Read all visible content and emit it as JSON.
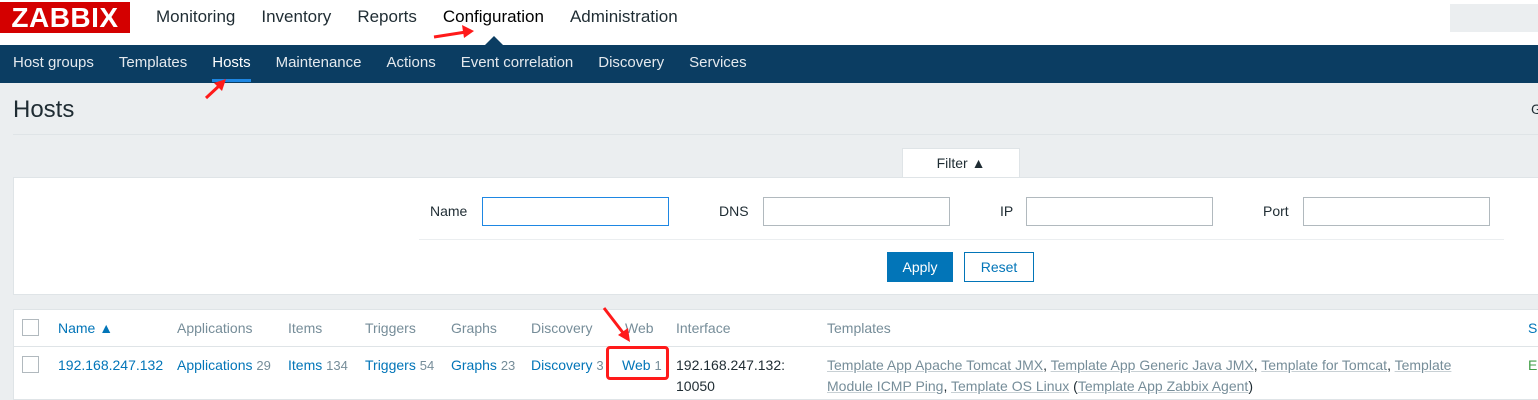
{
  "app": {
    "logo": "ZABBIX",
    "main_nav": [
      "Monitoring",
      "Inventory",
      "Reports",
      "Configuration",
      "Administration"
    ],
    "active_main": "Configuration",
    "sub_nav": [
      "Host groups",
      "Templates",
      "Hosts",
      "Maintenance",
      "Actions",
      "Event correlation",
      "Discovery",
      "Services"
    ],
    "active_sub": "Hosts"
  },
  "page": {
    "title": "Hosts",
    "right_glyph": "G"
  },
  "filter": {
    "tab_label": "Filter ▲",
    "fields": [
      {
        "label": "Name",
        "value": ""
      },
      {
        "label": "DNS",
        "value": ""
      },
      {
        "label": "IP",
        "value": ""
      },
      {
        "label": "Port",
        "value": ""
      }
    ],
    "apply_label": "Apply",
    "reset_label": "Reset"
  },
  "table": {
    "columns": [
      "Name ▲",
      "Applications",
      "Items",
      "Triggers",
      "Graphs",
      "Discovery",
      "Web",
      "Interface",
      "Templates",
      "S"
    ],
    "row": {
      "name": "192.168.247.132",
      "applications": {
        "label": "Applications",
        "count": "29"
      },
      "items": {
        "label": "Items",
        "count": "134"
      },
      "triggers": {
        "label": "Triggers",
        "count": "54"
      },
      "graphs": {
        "label": "Graphs",
        "count": "23"
      },
      "discovery": {
        "label": "Discovery",
        "count": "3"
      },
      "web": {
        "label": "Web",
        "count": "1"
      },
      "interface_line1": "192.168.247.132:",
      "interface_line2": "10050",
      "templates": [
        "Template App Apache Tomcat JMX",
        "Template App Generic Java JMX",
        "Template for Tomcat",
        "Template",
        "Module ICMP Ping",
        "Template OS Linux",
        "Template App Zabbix Agent"
      ],
      "status": "E"
    }
  },
  "colors": {
    "brand_red": "#d40000",
    "nav_dark": "#0b3d62",
    "link_blue": "#0275b8",
    "annotation_red": "#ff1a1a"
  }
}
